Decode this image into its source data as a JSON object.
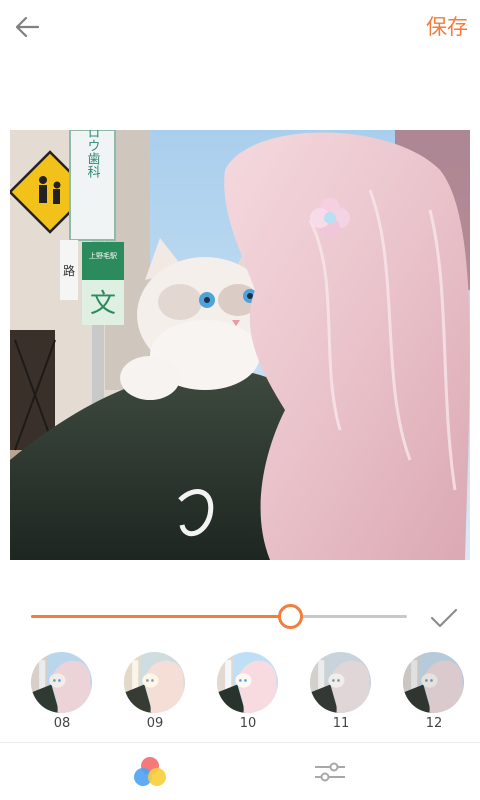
{
  "header": {
    "back_icon": "arrow-left-icon",
    "save_label": "保存",
    "accent_color": "#f47c3c"
  },
  "photo": {
    "sign_text_1": "ロウ歯科",
    "sign_text_2": "上野毛駅",
    "sign_text_3": "文",
    "sign_text_4": "路"
  },
  "adjust": {
    "value": 0.69,
    "confirm_icon": "checkmark-icon"
  },
  "filters": [
    {
      "label": "08"
    },
    {
      "label": "09"
    },
    {
      "label": "10"
    },
    {
      "label": "11"
    },
    {
      "label": "12"
    }
  ],
  "tabs": [
    {
      "icon": "color-filter-icon",
      "active": true
    },
    {
      "icon": "adjust-sliders-icon",
      "active": false
    }
  ]
}
